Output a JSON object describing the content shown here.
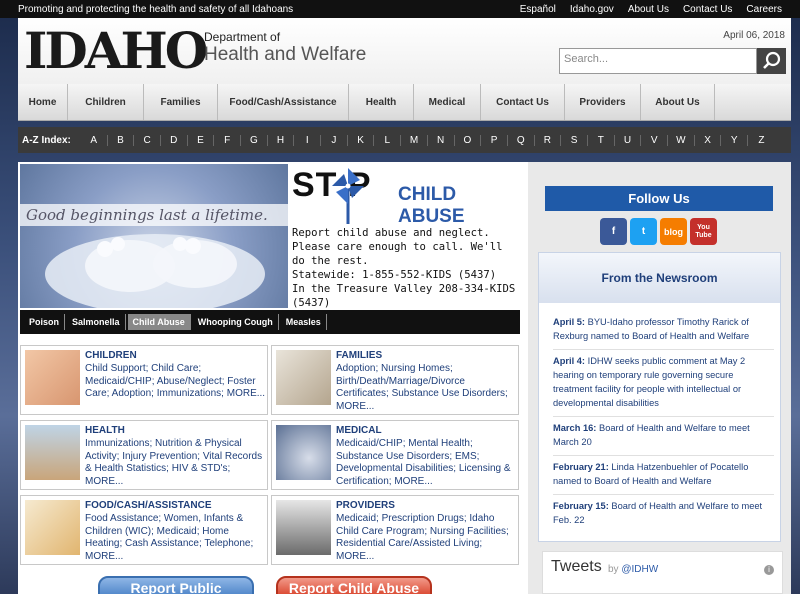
{
  "topbar": {
    "tagline": "Promoting and protecting the health and safety of all Idahoans",
    "links": [
      "Español",
      "Idaho.gov",
      "About Us",
      "Contact Us",
      "Careers"
    ]
  },
  "header": {
    "logo_text": "IDAHO",
    "dept_line1": "Department of",
    "dept_line2": "Health and Welfare",
    "date": "April 06, 2018",
    "search_placeholder": "Search..."
  },
  "nav": {
    "items": [
      "Home",
      "Children",
      "Families",
      "Food/Cash/Assistance",
      "Health",
      "Medical",
      "Contact Us",
      "Providers",
      "About Us"
    ]
  },
  "az": {
    "label": "A-Z Index:",
    "letters": [
      "A",
      "B",
      "C",
      "D",
      "E",
      "F",
      "G",
      "H",
      "I",
      "J",
      "K",
      "L",
      "M",
      "N",
      "O",
      "P",
      "Q",
      "R",
      "S",
      "T",
      "U",
      "V",
      "W",
      "X",
      "Y",
      "Z"
    ]
  },
  "banner": {
    "tagline": "Good beginnings last a lifetime.",
    "stop": "ST P",
    "headline": "CHILD ABUSE",
    "line1": "Report child abuse and neglect.  Please care enough to call.  We'll do the rest.",
    "line2": "Statewide: 1-855-552-KIDS (5437)",
    "line3": "In the Treasure Valley 208-334-KIDS (5437)",
    "tabs": [
      "Poison",
      "Salmonella",
      "Child Abuse",
      "Whooping Cough",
      "Measles"
    ],
    "active_tab": 2
  },
  "categories": [
    {
      "title": "CHILDREN",
      "desc": "Child Support; Child Care; Medicaid/CHIP; Abuse/Neglect; Foster Care; Adoption; Immunizations; MORE..."
    },
    {
      "title": "FAMILIES",
      "desc": "Adoption; Nursing Homes; Birth/Death/Marriage/Divorce Certificates; Substance Use Disorders; MORE..."
    },
    {
      "title": "HEALTH",
      "desc": "Immunizations; Nutrition & Physical Activity; Injury Prevention; Vital Records & Health Statistics; HIV & STD's; MORE..."
    },
    {
      "title": "MEDICAL",
      "desc": "Medicaid/CHIP; Mental Health; Substance Use Disorders; EMS; Developmental Disabilities; Licensing & Certification; MORE..."
    },
    {
      "title": "FOOD/CASH/ASSISTANCE",
      "desc": "Food Assistance; Women, Infants & Children (WIC); Medicaid; Home Heating; Cash Assistance; Telephone; MORE..."
    },
    {
      "title": "PROVIDERS",
      "desc": "Medicaid; Prescription Drugs; Idaho Child Care Program; Nursing Facilities; Residential Care/Assisted Living; MORE..."
    }
  ],
  "report_buttons": [
    "Report Public",
    "Report Child Abuse"
  ],
  "follow": {
    "title": "Follow Us",
    "socials": [
      "f",
      "t",
      "blog",
      "You Tube"
    ]
  },
  "newsroom": {
    "title": "From the Newsroom",
    "items": [
      {
        "date": "April 5:",
        "text": " BYU-Idaho professor Timothy Rarick of Rexburg named to Board of Health and Welfare"
      },
      {
        "date": "April 4:",
        "text": " IDHW seeks public comment at May 2 hearing on temporary rule governing secure treatment facility for people with intellectual or developmental disabilities"
      },
      {
        "date": "March 16:",
        "text": " Board of Health and Welfare to meet March 20"
      },
      {
        "date": "February 21:",
        "text": " Linda Hatzenbuehler of Pocatello named to Board of Health and Welfare"
      },
      {
        "date": "February 15:",
        "text": " Board of Health and Welfare to meet Feb. 22"
      }
    ]
  },
  "tweets": {
    "title": "Tweets",
    "by": "by",
    "handle": "@IDHW"
  },
  "colors": {
    "brand_blue": "#1f5aa8",
    "link_blue": "#1f3f7a"
  }
}
